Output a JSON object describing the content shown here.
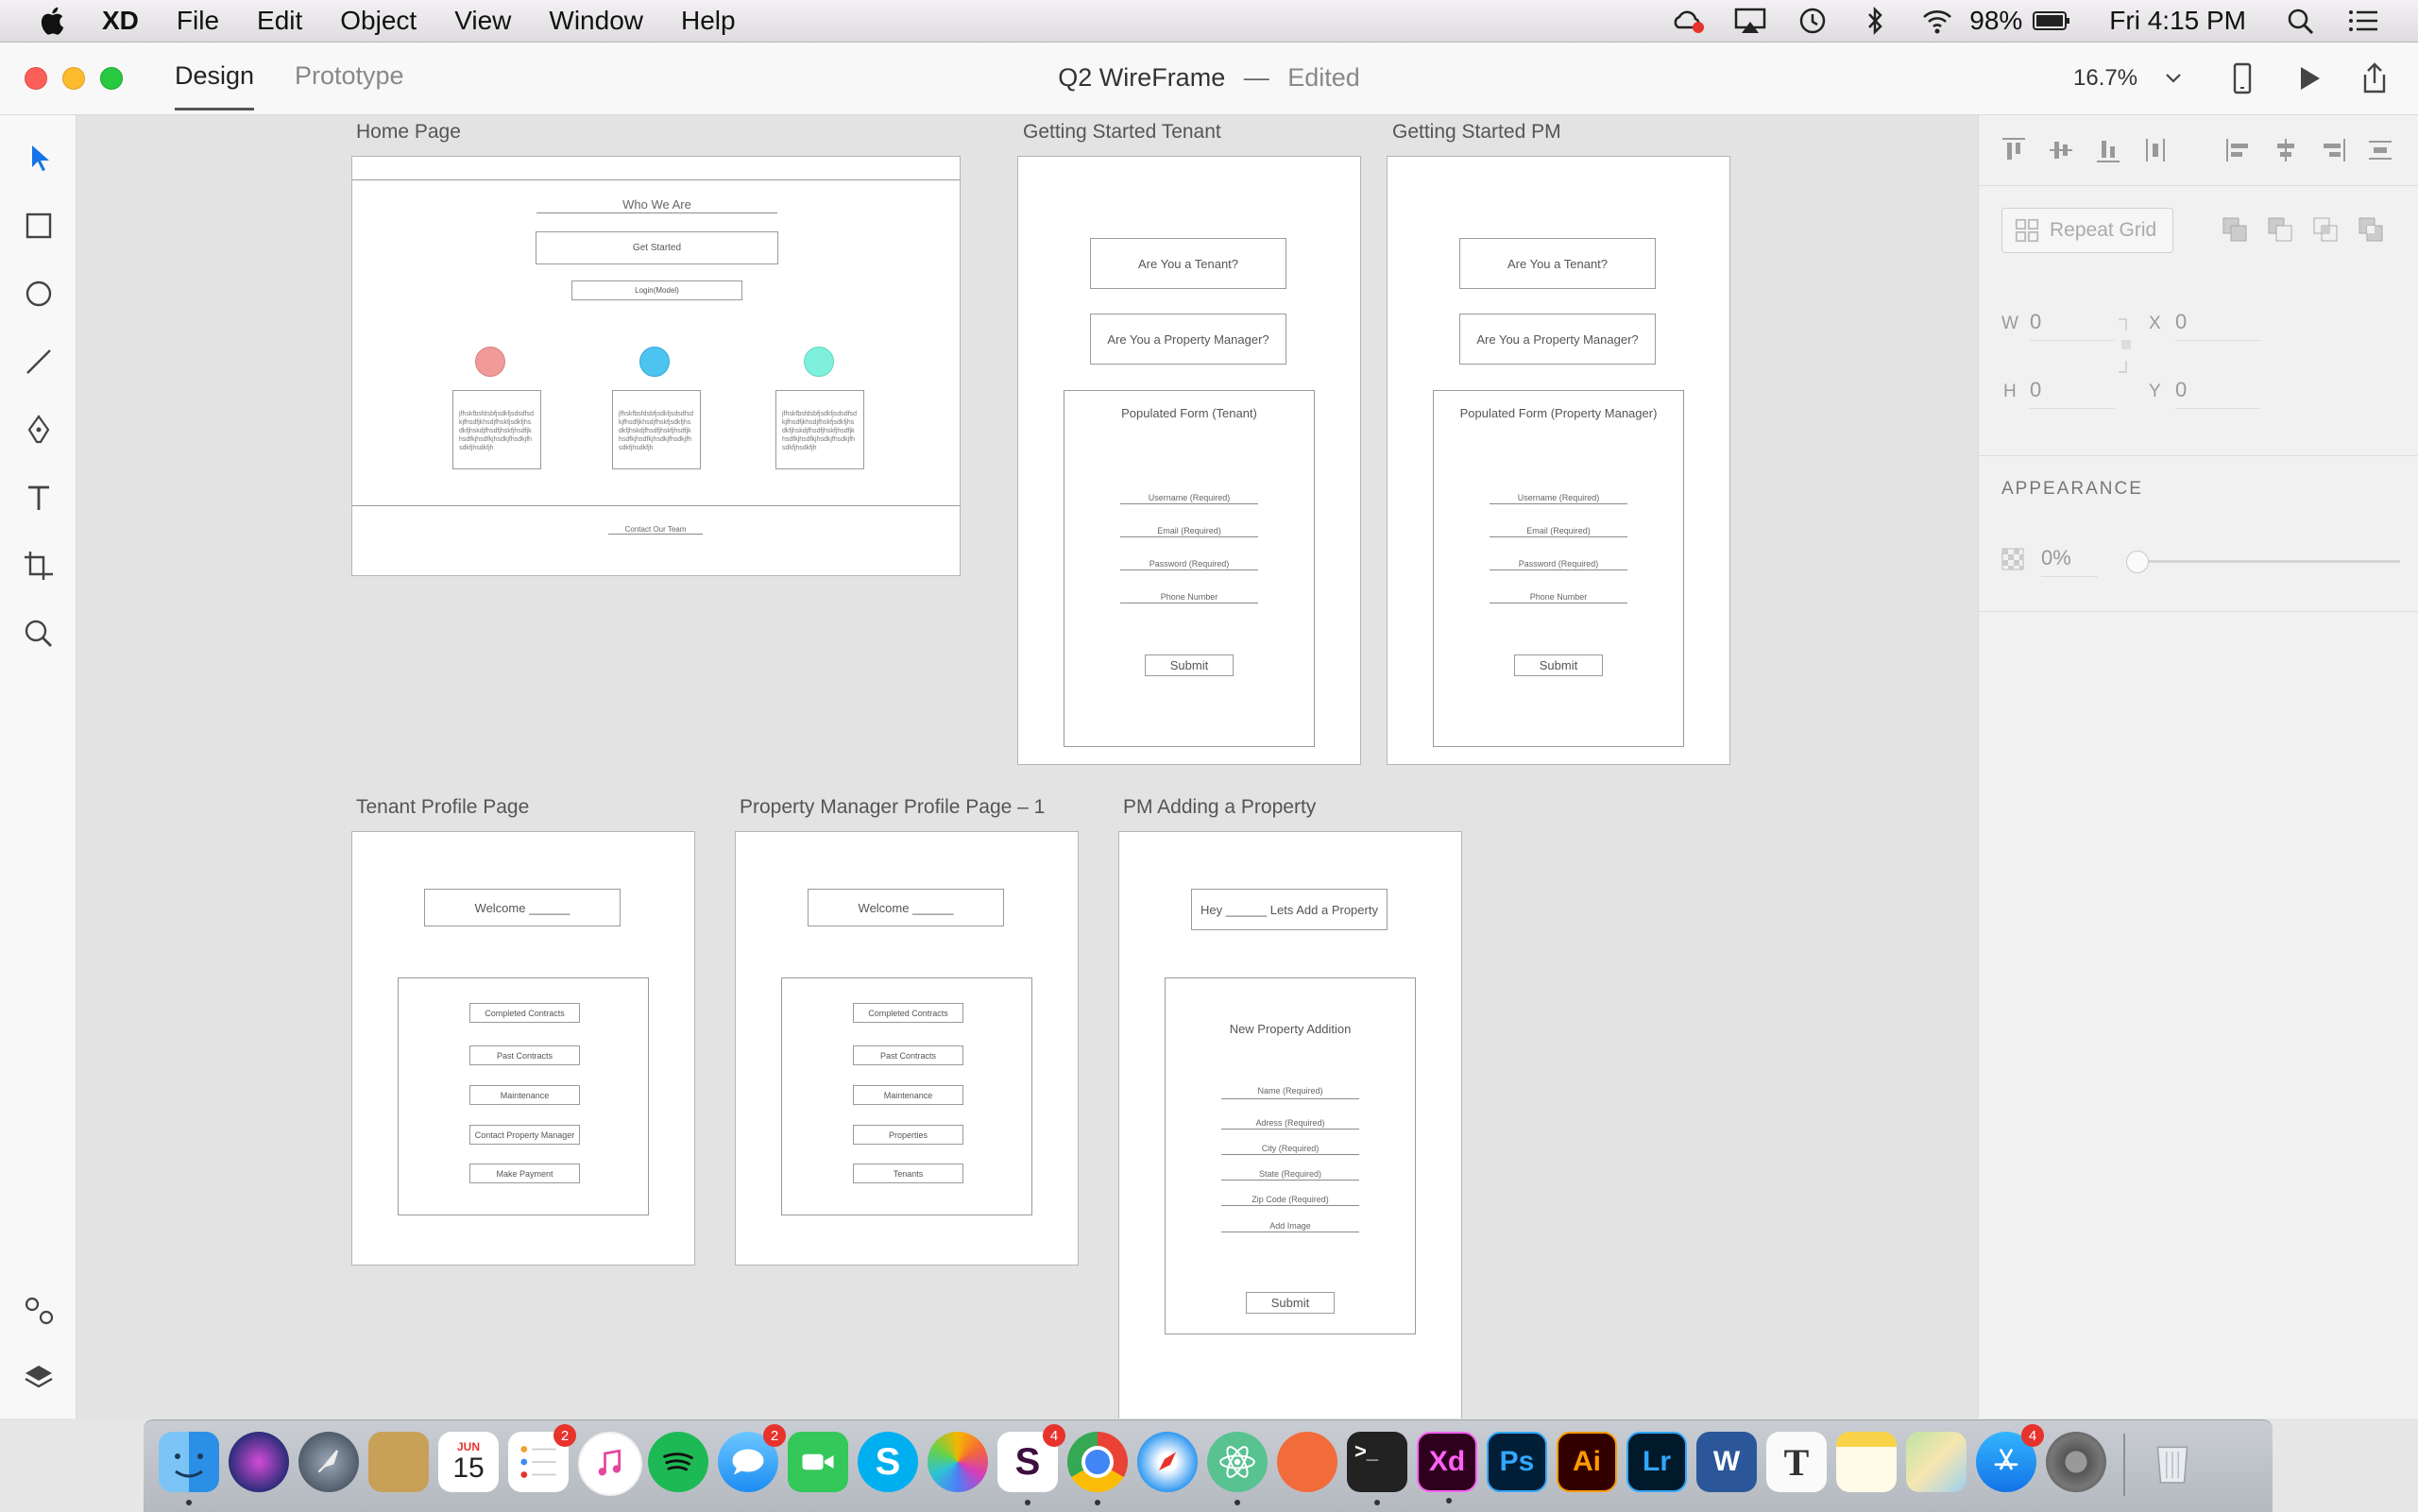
{
  "menubar": {
    "app_name": "XD",
    "items": [
      "File",
      "Edit",
      "Object",
      "View",
      "Window",
      "Help"
    ],
    "battery": "98%",
    "clock": "Fri 4:15 PM"
  },
  "titlebar": {
    "tab_design": "Design",
    "tab_prototype": "Prototype",
    "doc_name": "Q2 WireFrame",
    "separator": "—",
    "doc_status": "Edited",
    "zoom": "16.7%"
  },
  "artboards": {
    "home": {
      "label": "Home Page",
      "who_we_are": "Who We Are",
      "get_started": "Get Started",
      "login": "Login(Model)",
      "lorem": "jfhskfbsfdsbfjsdkfjsdsdfsdkjfhsdfjkhsdjfhskfjsdkfjhsdkfjhskdjfhsdfjhskfjhsdfjkhsdfkjhsdfkjhsdkjfhsdkjfhsdkfjhsdkfjh",
      "contact": "Contact Our Team",
      "dot_colors": [
        "#f09a9a",
        "#4cc3f0",
        "#7ff0dc"
      ]
    },
    "tenant_start": {
      "label": "Getting Started Tenant",
      "q1": "Are You a Tenant?",
      "q2": "Are You a Property Manager?",
      "form_title": "Populated Form (Tenant)",
      "fields": [
        "Username (Required)",
        "Email (Required)",
        "Password (Required)",
        "Phone Number"
      ],
      "submit": "Submit"
    },
    "pm_start": {
      "label": "Getting Started PM",
      "q1": "Are You a Tenant?",
      "q2": "Are You a Property Manager?",
      "form_title": "Populated Form (Property Manager)",
      "fields": [
        "Username (Required)",
        "Email (Required)",
        "Password (Required)",
        "Phone Number"
      ],
      "submit": "Submit"
    },
    "tenant_profile": {
      "label": "Tenant Profile Page",
      "welcome": "Welcome ______",
      "buttons": [
        "Completed Contracts",
        "Past Contracts",
        "Maintenance",
        "Contact Property Manager",
        "Make Payment"
      ]
    },
    "pm_profile": {
      "label": "Property Manager Profile Page – 1",
      "welcome": "Welcome ______",
      "buttons": [
        "Completed Contracts",
        "Past Contracts",
        "Maintenance",
        "Properties",
        "Tenants"
      ]
    },
    "pm_add": {
      "label": "PM Adding a Property",
      "greeting": "Hey ______ Lets Add a Property",
      "form_title": "New Property Addition",
      "fields": [
        "Name (Required)",
        "Adress (Required)",
        "City (Required)",
        "State (Required)",
        "Zip Code (Required)",
        "Add Image"
      ],
      "submit": "Submit"
    }
  },
  "props": {
    "repeat_grid": "Repeat Grid",
    "w_label": "W",
    "w_value": "0",
    "x_label": "X",
    "x_value": "0",
    "h_label": "H",
    "h_value": "0",
    "y_label": "Y",
    "y_value": "0",
    "appearance_title": "APPEARANCE",
    "opacity": "0%",
    "opacity_level": 0
  },
  "dock": {
    "calendar_month": "JUN",
    "calendar_day": "15",
    "reminders_badge": "2",
    "messages_badge": "2",
    "slack_badge": "4",
    "appstore_badge": "4",
    "xd_label": "Xd",
    "ps_label": "Ps",
    "ai_label": "Ai",
    "lr_label": "Lr",
    "word_label": "W",
    "typora_label": "T",
    "terminal_label": ">_"
  }
}
